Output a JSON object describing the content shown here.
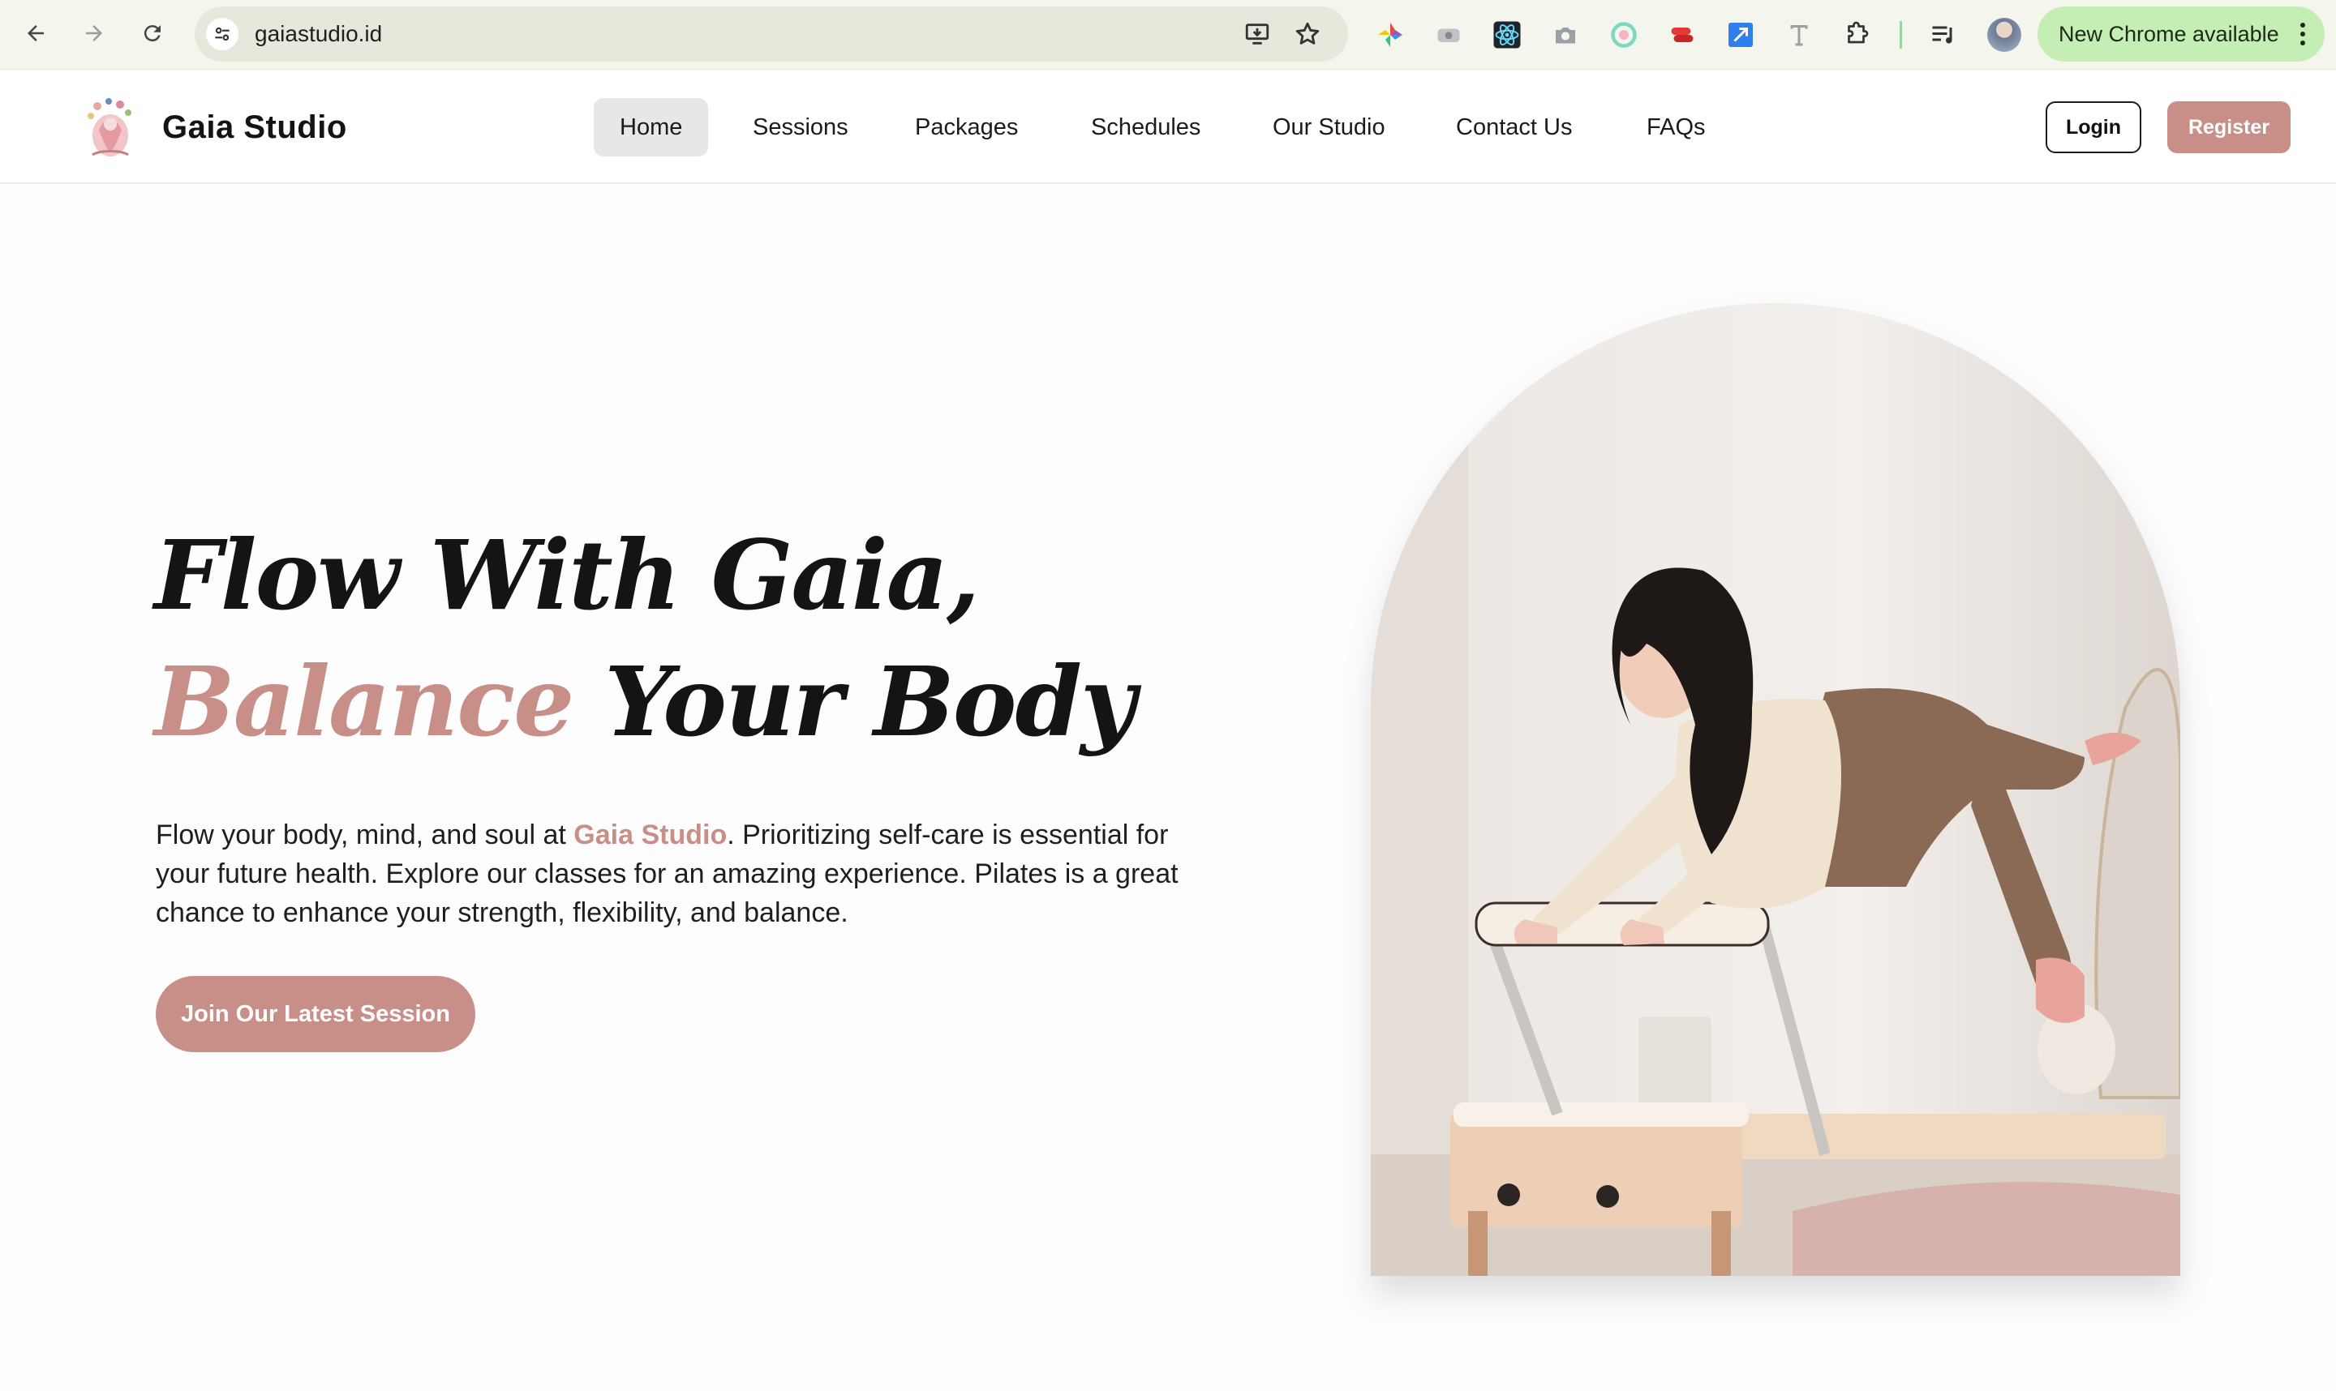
{
  "browser": {
    "url": "gaiastudio.id",
    "update_label": "New Chrome available",
    "icons": {
      "back": "arrow-left-icon",
      "forward": "arrow-right-icon",
      "reload": "reload-icon",
      "site_info": "tune-icon",
      "install": "install-app-icon",
      "bookmark": "star-icon",
      "reading_list": "queue-music-icon",
      "extensions": "puzzle-icon"
    }
  },
  "site": {
    "brand": "Gaia Studio",
    "nav": [
      "Home",
      "Sessions",
      "Packages",
      "Schedules",
      "Our Studio",
      "Contact Us",
      "FAQs"
    ],
    "active_nav": "Home",
    "login_label": "Login",
    "register_label": "Register"
  },
  "hero": {
    "title_line1": "Flow With Gaia,",
    "title_accent": "Balance",
    "title_rest": " Your Body",
    "text_before": "Flow your body, mind, and soul at ",
    "text_brand": "Gaia Studio",
    "text_after": ". Prioritizing self-care is essential for your future health. Explore our classes for an amazing experience. Pilates is a great chance to enhance your strength, flexibility, and balance.",
    "cta_label": "Join Our Latest Session"
  },
  "colors": {
    "accent": "#c88f88",
    "update_pill": "#c5eeb5",
    "browser_bar": "#f4f6ee"
  }
}
